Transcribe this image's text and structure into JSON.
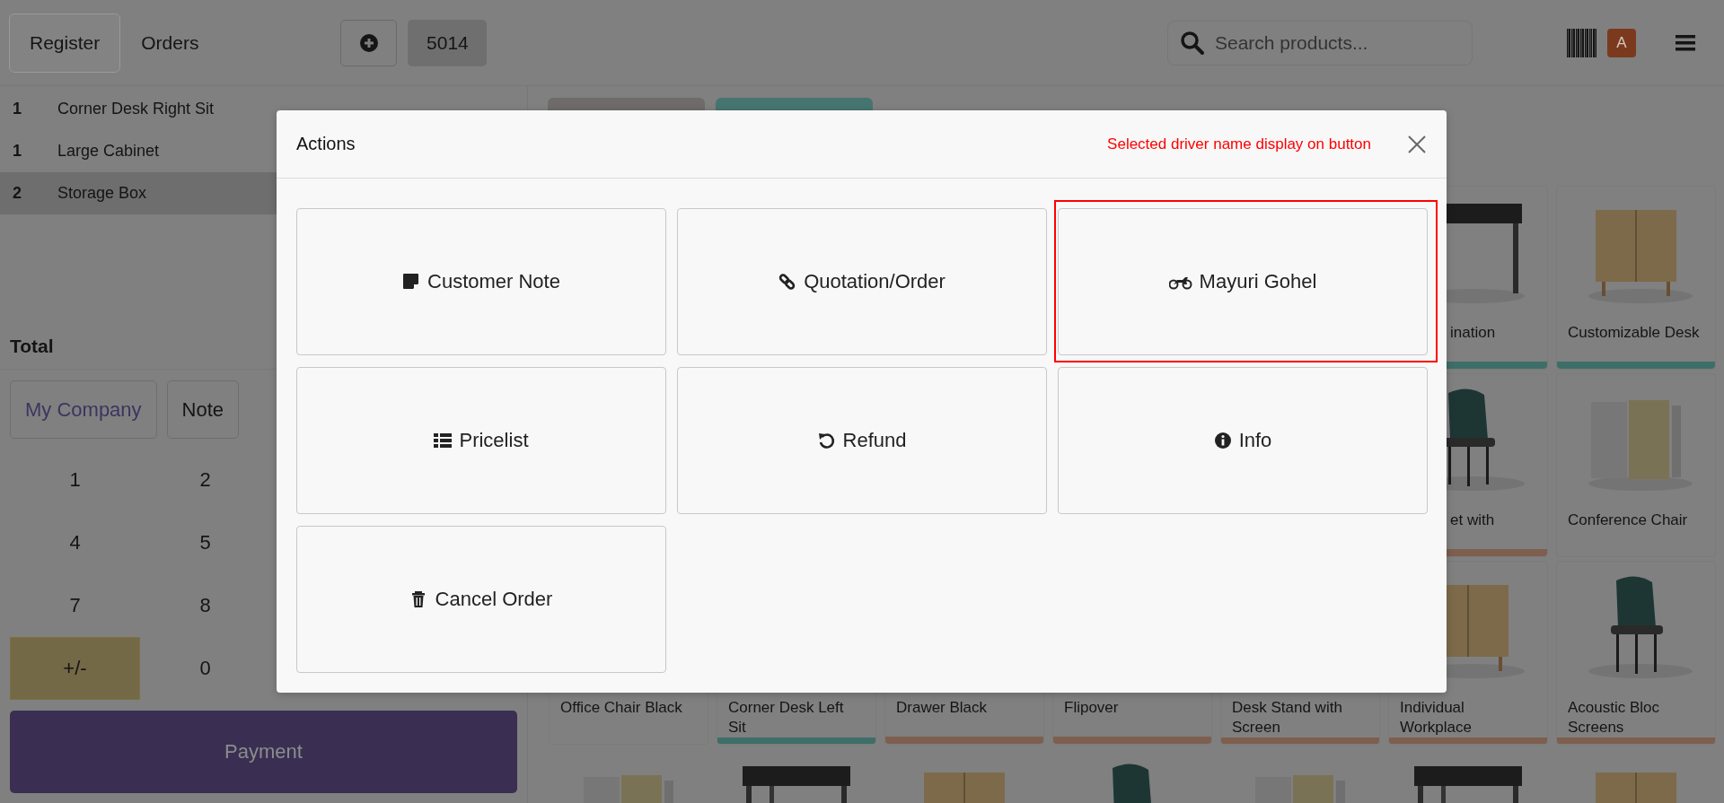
{
  "topbar": {
    "tabs": [
      {
        "label": "Register",
        "selected": true
      },
      {
        "label": "Orders",
        "selected": false
      }
    ],
    "order_number": "5014",
    "search": {
      "placeholder": "Search products..."
    },
    "avatar": "A"
  },
  "order_lines": [
    {
      "qty": "1",
      "name": "Corner Desk Right Sit",
      "selected": false
    },
    {
      "qty": "1",
      "name": "Large Cabinet",
      "selected": false
    },
    {
      "qty": "2",
      "name": "Storage Box",
      "selected": true
    }
  ],
  "total_label": "Total",
  "customer_button": "My Company",
  "note_button": "Note",
  "numpad": [
    {
      "label": "1",
      "kind": "digit"
    },
    {
      "label": "2",
      "kind": "digit"
    },
    {
      "label": "4",
      "kind": "digit"
    },
    {
      "label": "5",
      "kind": "digit"
    },
    {
      "label": "7",
      "kind": "digit"
    },
    {
      "label": "8",
      "kind": "digit"
    },
    {
      "label": "+/-",
      "kind": "sign"
    },
    {
      "label": "0",
      "kind": "digit"
    }
  ],
  "payment_button": "Payment",
  "categories": [
    {
      "color": "#6f6b6b"
    },
    {
      "color": "#467570"
    }
  ],
  "product_rows": [
    [
      {
        "name": "ination",
        "kind": "clipped",
        "color": "#3d6e68"
      },
      {
        "name": "Customizable Desk",
        "kind": "full",
        "color": "#3d6e68"
      }
    ],
    [
      {
        "name": "et with",
        "kind": "clipped",
        "color": "#7e5e4e"
      },
      {
        "name": "Conference Chair",
        "kind": "full"
      }
    ],
    [
      {
        "name": "Office Chair Black",
        "kind": "covered"
      },
      {
        "name": "Corner Desk Left Sit",
        "kind": "covered",
        "color": "#3d6e68"
      },
      {
        "name": "Drawer Black",
        "kind": "covered",
        "color": "#7e5e4e"
      },
      {
        "name": "Flipover",
        "kind": "covered",
        "color": "#7e5e4e"
      },
      {
        "name": "Desk Stand with Screen",
        "kind": "covered",
        "color": "#7e5e4e"
      },
      {
        "name": "Individual Workplace",
        "kind": "full",
        "color": "#7e5e4e"
      },
      {
        "name": "Acoustic Bloc Screens",
        "kind": "full",
        "color": "#7e5e4e"
      }
    ],
    [
      {
        "kind": "picture"
      },
      {
        "kind": "picture"
      },
      {
        "kind": "picture"
      },
      {
        "kind": "picture"
      },
      {
        "kind": "picture"
      },
      {
        "kind": "picture"
      },
      {
        "kind": "picture"
      }
    ]
  ],
  "modal": {
    "title": "Actions",
    "note": "Selected driver name display on button",
    "actions": [
      {
        "label": "Customer Note",
        "kind": "note",
        "highlighted": false
      },
      {
        "label": "Quotation/Order",
        "kind": "link",
        "highlighted": false
      },
      {
        "label": "Mayuri Gohel",
        "kind": "motorcycle",
        "highlighted": true
      },
      {
        "label": "Pricelist",
        "kind": "list",
        "highlighted": false
      },
      {
        "label": "Refund",
        "kind": "undo",
        "highlighted": false
      },
      {
        "label": "Info",
        "kind": "info",
        "highlighted": false
      },
      {
        "label": "Cancel Order",
        "kind": "trash",
        "highlighted": false
      }
    ]
  }
}
